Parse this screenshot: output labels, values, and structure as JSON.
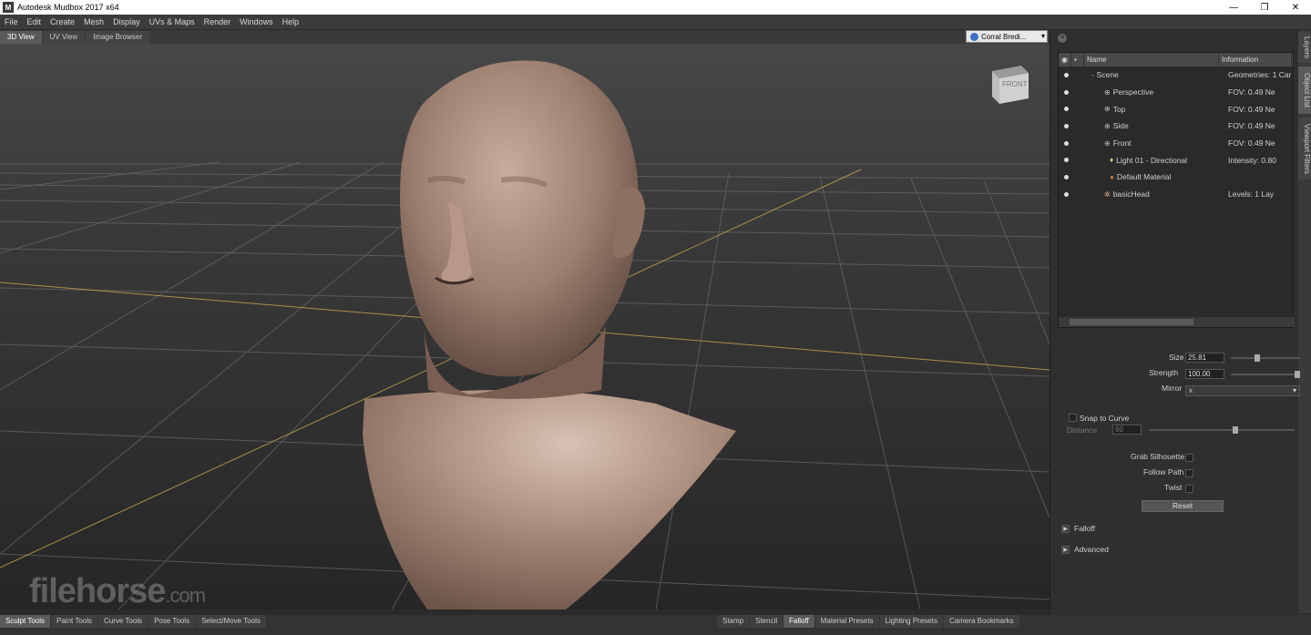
{
  "window": {
    "title": "Autodesk Mudbox 2017 x64",
    "app_icon": "M",
    "controls": {
      "minimize": "—",
      "maximize": "❐",
      "close": "✕"
    }
  },
  "menu": [
    "File",
    "Edit",
    "Create",
    "Mesh",
    "Display",
    "UVs & Maps",
    "Render",
    "Windows",
    "Help"
  ],
  "view_tabs": [
    "3D View",
    "UV View",
    "Image Browser"
  ],
  "user": {
    "name": "Corral Bredi..."
  },
  "viewcube": {
    "label": "FRONT"
  },
  "watermark": {
    "brand": "filehorse",
    "suffix": ".com"
  },
  "panel": {
    "vertical_tabs": [
      "Layers",
      "Object List",
      "Viewport Filters"
    ],
    "outliner": {
      "headers": {
        "name": "Name",
        "info": "Information"
      },
      "rows": [
        {
          "name": "Scene",
          "info": "Geometries: 1  Car"
        },
        {
          "name": "Perspective",
          "info": "FOV: 0.49   Ne"
        },
        {
          "name": "Top",
          "info": "FOV: 0.49   Ne"
        },
        {
          "name": "Side",
          "info": "FOV: 0.49   Ne"
        },
        {
          "name": "Front",
          "info": "FOV: 0.49   Ne"
        },
        {
          "name": "Light 01 - Directional",
          "info": "Intensity: 0.80"
        },
        {
          "name": "Default Material",
          "info": ""
        },
        {
          "name": "basicHead",
          "info": "Levels: 1   Lay"
        }
      ]
    },
    "properties": {
      "size_label": "Size",
      "size_value": "25.81",
      "strength_label": "Strength",
      "strength_value": "100.00",
      "mirror_label": "Mirror",
      "mirror_value": "x",
      "snap_label": "Snap to Curve",
      "distance_label": "Distance",
      "distance_value": "60",
      "grab_label": "Grab Silhouette",
      "follow_label": "Follow Path",
      "twist_label": "Twist",
      "reset_label": "Reset",
      "falloff_label": "Falloff",
      "advanced_label": "Advanced"
    }
  },
  "bottom_tabs_left": [
    "Sculpt Tools",
    "Paint Tools",
    "Curve Tools",
    "Pose Tools",
    "Select/Move Tools"
  ],
  "bottom_tabs_right": [
    "Stamp",
    "Stencil",
    "Falloff",
    "Material Presets",
    "Lighting Presets",
    "Camera Bookmarks"
  ]
}
